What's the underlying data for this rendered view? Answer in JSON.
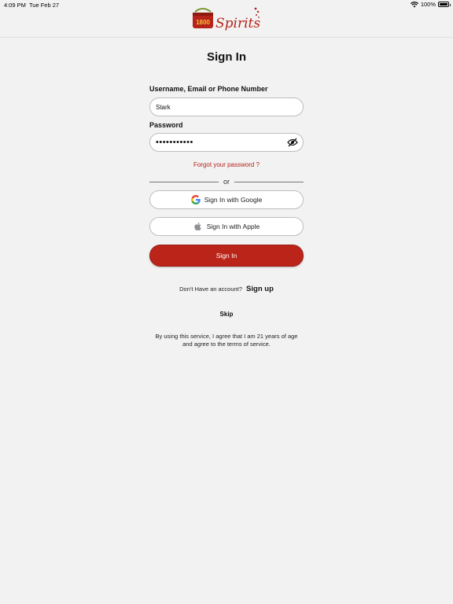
{
  "status_bar": {
    "time": "4:09 PM",
    "date": "Tue Feb 27",
    "battery": "100%"
  },
  "brand": {
    "badge_text": "1800",
    "script_text": "Spirits",
    "color": "#b5231a"
  },
  "page": {
    "title": "Sign In"
  },
  "form": {
    "username_label": "Username, Email or Phone Number",
    "username_value": "Stark",
    "password_label": "Password",
    "password_value": "•••••••••••",
    "forgot_label": "Forgot your password ?",
    "or_label": "or"
  },
  "sso": {
    "google_label": "Sign In with Google",
    "apple_label": "Sign In with Apple"
  },
  "actions": {
    "sign_in_label": "Sign In",
    "sign_in_color": "#bb2419",
    "account_prompt": "Don't Have an account?",
    "sign_up_label": "Sign up",
    "skip_label": "Skip"
  },
  "terms": {
    "line1": "By using this service, I agree that I am 21 years of age",
    "line2": "and  agree to the terms of service."
  }
}
